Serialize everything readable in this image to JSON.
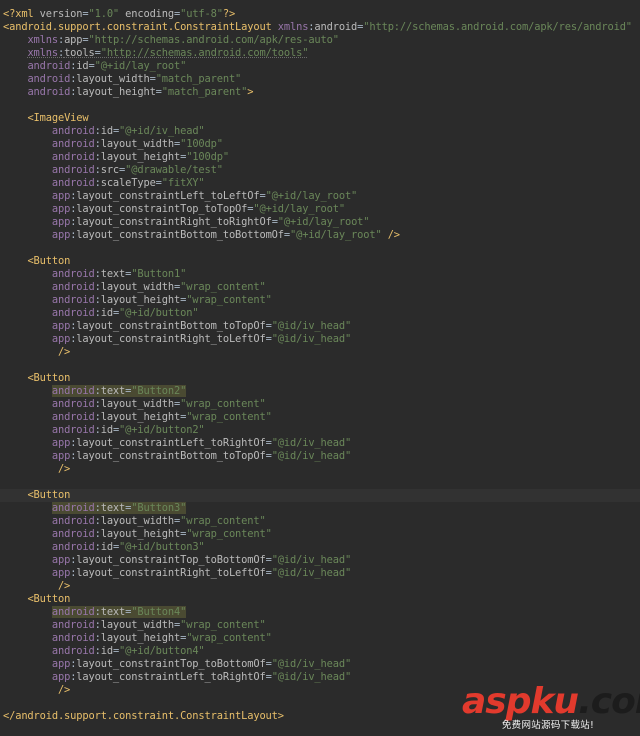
{
  "editor": {
    "lines": [
      "<?xml version=\"1.0\" encoding=\"utf-8\"?>",
      "<android.support.constraint.ConstraintLayout xmlns:android=\"http://schemas.android.com/apk/res/android\"",
      "    xmlns:app=\"http://schemas.android.com/apk/res-auto\"",
      "    xmlns:tools=\"http://schemas.android.com/tools\"",
      "    android:id=\"@+id/lay_root\"",
      "    android:layout_width=\"match_parent\"",
      "    android:layout_height=\"match_parent\">",
      "",
      "    <ImageView",
      "        android:id=\"@+id/iv_head\"",
      "        android:layout_width=\"100dp\"",
      "        android:layout_height=\"100dp\"",
      "        android:src=\"@drawable/test\"",
      "        android:scaleType=\"fitXY\"",
      "        app:layout_constraintLeft_toLeftOf=\"@+id/lay_root\"",
      "        app:layout_constraintTop_toTopOf=\"@+id/lay_root\"",
      "        app:layout_constraintRight_toRightOf=\"@+id/lay_root\"",
      "        app:layout_constraintBottom_toBottomOf=\"@+id/lay_root\" />",
      "",
      "    <Button",
      "        android:text=\"Button1\"",
      "        android:layout_width=\"wrap_content\"",
      "        android:layout_height=\"wrap_content\"",
      "        android:id=\"@+id/button\"",
      "        app:layout_constraintBottom_toTopOf=\"@id/iv_head\"",
      "        app:layout_constraintRight_toLeftOf=\"@id/iv_head\"",
      "         />",
      "",
      "    <Button",
      "        android:text=\"Button2\"",
      "        android:layout_width=\"wrap_content\"",
      "        android:layout_height=\"wrap_content\"",
      "        android:id=\"@+id/button2\"",
      "        app:layout_constraintLeft_toRightOf=\"@id/iv_head\"",
      "        app:layout_constraintBottom_toTopOf=\"@id/iv_head\"",
      "         />",
      "",
      "    <Button",
      "        android:text=\"Button3\"",
      "        android:layout_width=\"wrap_content\"",
      "        android:layout_height=\"wrap_content\"",
      "        android:id=\"@+id/button3\"",
      "        app:layout_constraintTop_toBottomOf=\"@id/iv_head\"",
      "        app:layout_constraintRight_toLeftOf=\"@id/iv_head\"",
      "         />",
      "    <Button",
      "        android:text=\"Button4\"",
      "        android:layout_width=\"wrap_content\"",
      "        android:layout_height=\"wrap_content\"",
      "        android:id=\"@+id/button4\"",
      "        app:layout_constraintTop_toBottomOf=\"@id/iv_head\"",
      "        app:layout_constraintLeft_toRightOf=\"@id/iv_head\"",
      "         />",
      "",
      "</android.support.constraint.ConstraintLayout>"
    ],
    "caret_line": 37,
    "highlighted_attr_lines": [
      29,
      38,
      46
    ]
  },
  "watermark": {
    "logo_text": "aspku",
    "logo_tld": ".com",
    "subtitle": "免费网站源码下载站!"
  },
  "colors": {
    "background": "#2b2b2b",
    "tag": "#e8bf6a",
    "namespace": "#9876aa",
    "attribute": "#bababa",
    "value": "#6a8759",
    "text": "#a9b7c6",
    "watermark_red": "#e23a2d"
  }
}
